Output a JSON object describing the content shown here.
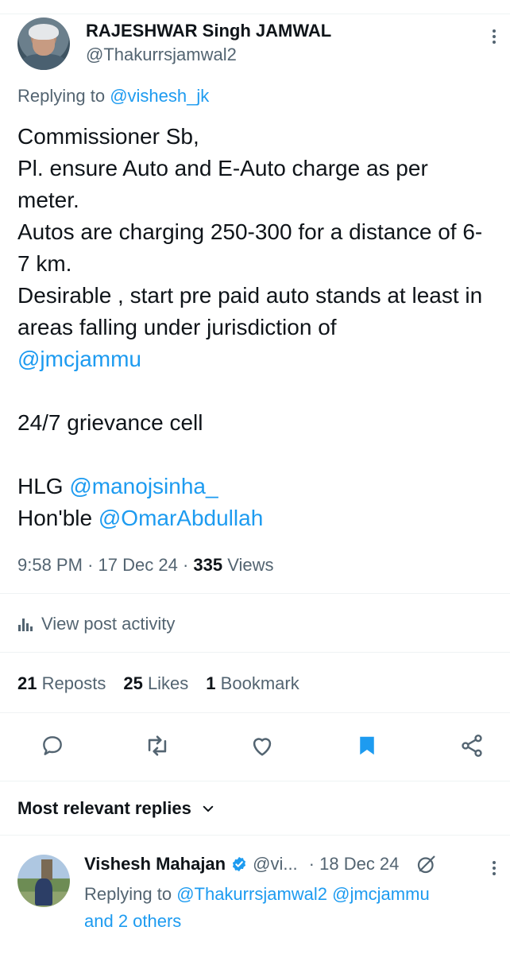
{
  "post": {
    "author_name": "RAJESHWAR Singh JAMWAL",
    "author_handle": "@Thakurrsjamwal2",
    "replying_prefix": "Replying to ",
    "replying_to": "@vishesh_jk",
    "text_lines": [
      "Commissioner Sb,",
      "Pl. ensure Auto and E-Auto charge as per meter.",
      "Autos are charging 250-300 for a distance of 6-7 km.",
      "Desirable , start pre paid auto stands at least in areas falling under jurisdiction of"
    ],
    "mention_jmc": "@jmcjammu",
    "grievance": "24/7 grievance cell",
    "hlg_prefix": "HLG ",
    "mention_manoj": "@manojsinha_",
    "honble_prefix": "Hon'ble ",
    "mention_omar": "@OmarAbdullah",
    "time": "9:58 PM",
    "dot": "·",
    "date": "17 Dec 24",
    "views_count": "335",
    "views_label": " Views"
  },
  "activity": {
    "label": "View post activity",
    "icon": "bar-chart-icon"
  },
  "stats": {
    "reposts_count": "21",
    "reposts_label": "Reposts",
    "likes_count": "25",
    "likes_label": "Likes",
    "bookmarks_count": "1",
    "bookmarks_label": "Bookmark"
  },
  "actions": {
    "icons": [
      "reply-icon",
      "repost-icon",
      "like-icon",
      "bookmark-icon",
      "share-icon"
    ],
    "bookmark_active_color": "#1d9bf0"
  },
  "replies_section": {
    "label": "Most relevant replies"
  },
  "reply": {
    "author_name": "Vishesh Mahajan",
    "author_handle": "@vi...",
    "time": "· 18 Dec 24",
    "replying_prefix": "Replying to ",
    "replying_to": "@Thakurrsjamwal2 @jmcjammu",
    "replying_more": "and 2 others",
    "verified_color": "#1d9bf0"
  },
  "colors": {
    "link": "#1d9bf0",
    "secondary_text": "#536471",
    "primary_text": "#0f1419"
  }
}
